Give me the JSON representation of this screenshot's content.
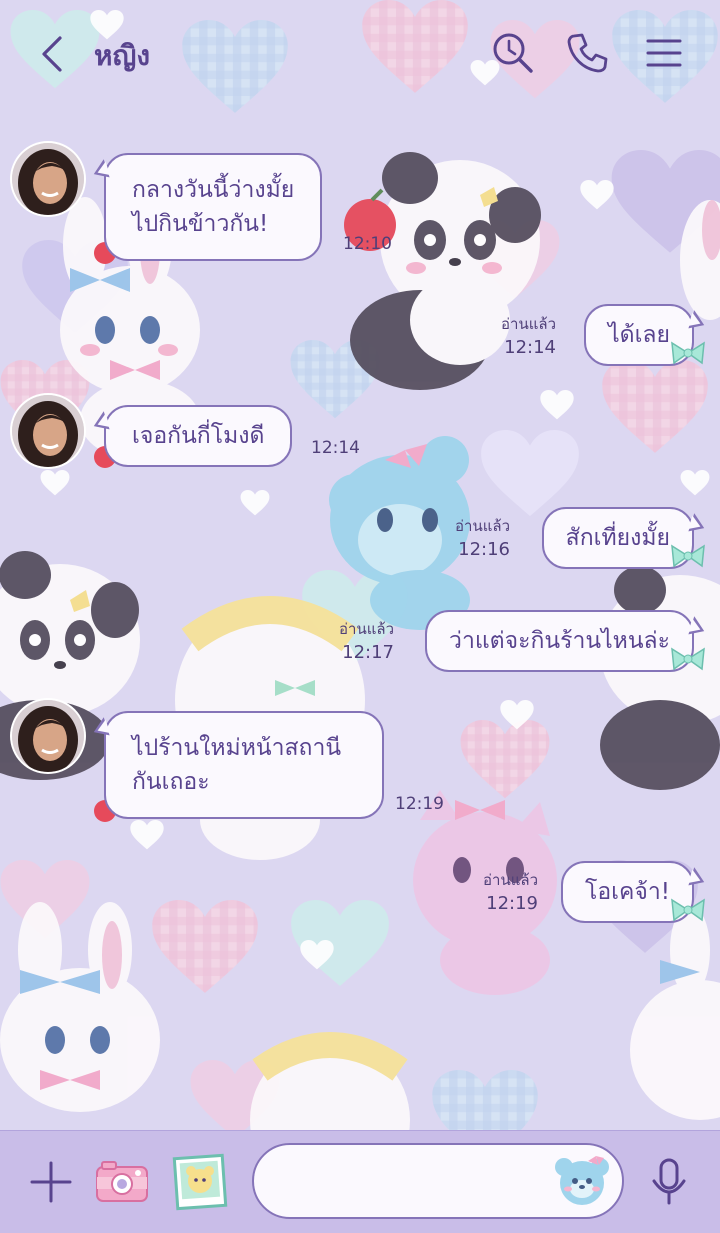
{
  "theme": {
    "accent": "#58438e",
    "bubble_border": "#8574b8",
    "bubble_fill": "#fbf9fe",
    "footer_bg": "#c9bde8",
    "wallpaper": "#dcd7f1"
  },
  "header": {
    "title": "หญิง",
    "back_icon": "chevron-left-icon",
    "search_icon": "search-icon",
    "call_icon": "phone-icon",
    "menu_icon": "hamburger-menu-icon"
  },
  "messages": [
    {
      "from": "them",
      "lines": [
        "กลางวันนี้ว่างมั้ย",
        "ไปกินข้าวกัน!"
      ],
      "time": "12:10"
    },
    {
      "from": "me",
      "text": "ได้เลย",
      "read": "อ่านแล้ว",
      "time": "12:14"
    },
    {
      "from": "them",
      "lines": [
        "เจอกันกี่โมงดี"
      ],
      "time": "12:14"
    },
    {
      "from": "me",
      "text": "สักเที่ยงมั้ย",
      "read": "อ่านแล้ว",
      "time": "12:16"
    },
    {
      "from": "me",
      "text": "ว่าแต่จะกินร้านไหนล่ะ",
      "read": "อ่านแล้ว",
      "time": "12:17"
    },
    {
      "from": "them",
      "lines": [
        "ไปร้านใหม่หน้าสถานี",
        "กันเถอะ"
      ],
      "time": "12:19"
    },
    {
      "from": "me",
      "text": "โอเคจ้า!",
      "read": "อ่านแล้ว",
      "time": "12:19"
    }
  ],
  "footer": {
    "plus_icon": "plus-icon",
    "camera_icon": "camera-icon",
    "photo_icon": "photo-album-icon",
    "input_value": "",
    "sticker_icon": "sticker-bear-icon",
    "mic_icon": "microphone-icon"
  }
}
